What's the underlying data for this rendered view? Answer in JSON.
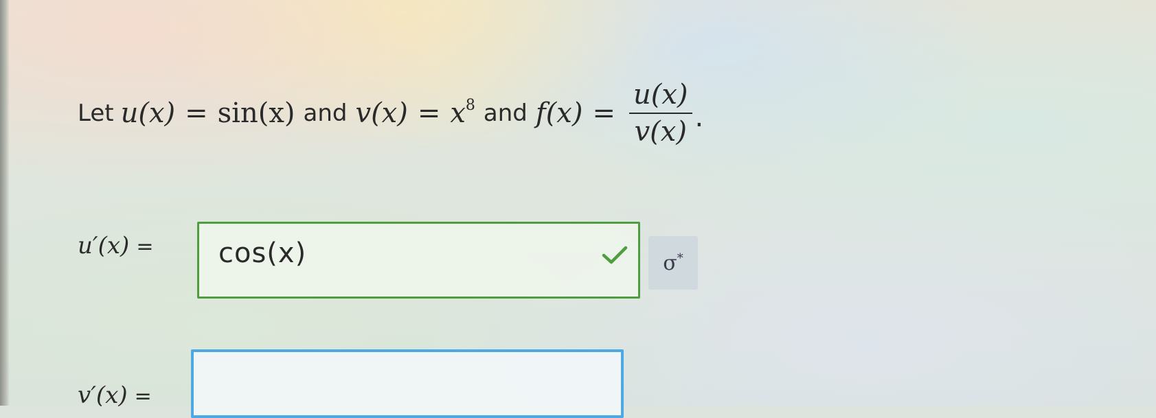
{
  "problem": {
    "let_word": "Let",
    "u_def_lhs": "u(x)",
    "equals": "=",
    "u_def_rhs": "sin(x)",
    "and_word_1": "and",
    "v_def_lhs": "v(x)",
    "v_def_base": "x",
    "v_def_exponent": "8",
    "and_word_2": "and",
    "f_def_lhs": "f(x)",
    "f_numerator": "u(x)",
    "f_denominator": "v(x)",
    "period": "."
  },
  "answers": [
    {
      "label": "u′(x)",
      "equals": "=",
      "value": "cos(x)",
      "status": "correct",
      "border_color": "#4e9d3e"
    },
    {
      "label": "v′(x)",
      "equals": "=",
      "value": "",
      "status": "active",
      "border_color": "#4da9e3"
    }
  ],
  "icons": {
    "check": "check-icon",
    "formula_editor": "sigma-icon"
  },
  "formula_button": {
    "glyph": "σ",
    "superscript": "*"
  }
}
